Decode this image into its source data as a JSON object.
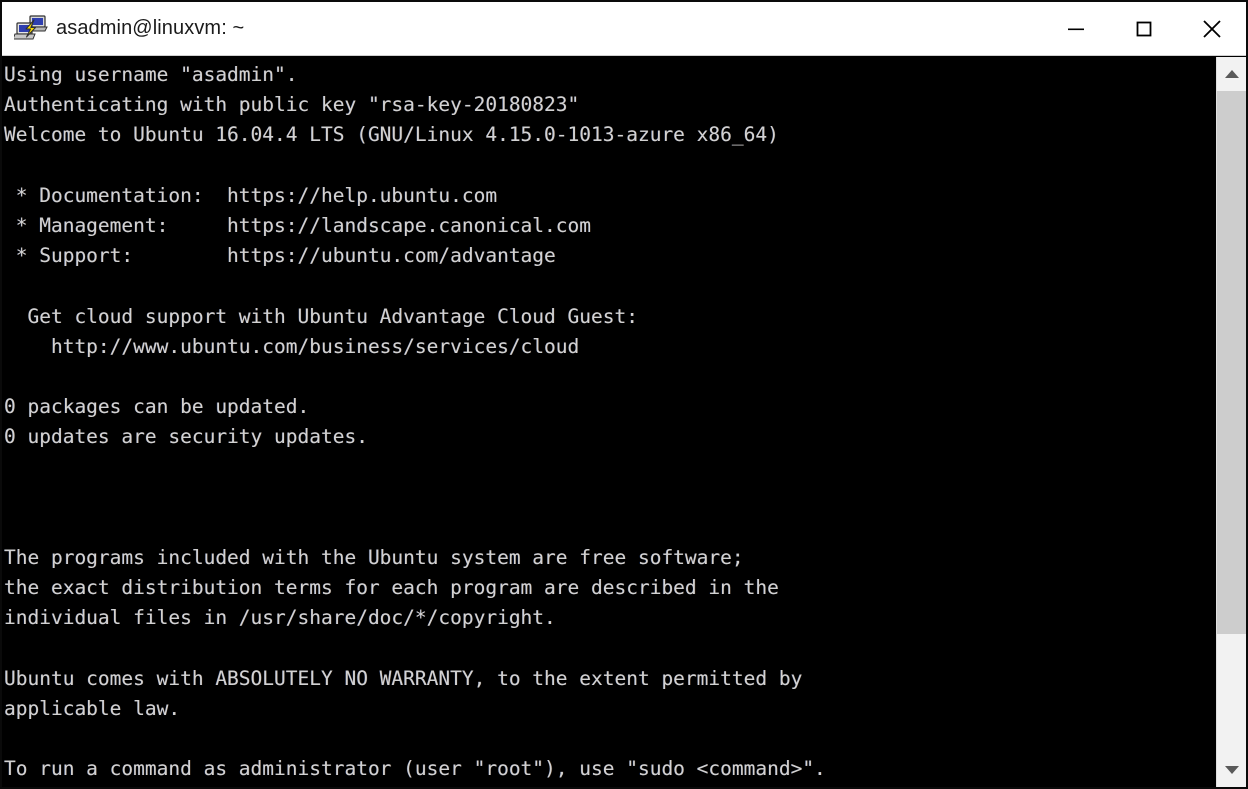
{
  "window": {
    "title": "asadmin@linuxvm: ~",
    "icon": "putty-icon",
    "controls": {
      "minimize_label": "Minimize",
      "maximize_label": "Maximize",
      "close_label": "Close"
    }
  },
  "terminal": {
    "background_color": "#000000",
    "text_color": "#d2d2d2",
    "lines": [
      "Using username \"asadmin\".",
      "Authenticating with public key \"rsa-key-20180823\"",
      "Welcome to Ubuntu 16.04.4 LTS (GNU/Linux 4.15.0-1013-azure x86_64)",
      "",
      " * Documentation:  https://help.ubuntu.com",
      " * Management:     https://landscape.canonical.com",
      " * Support:        https://ubuntu.com/advantage",
      "",
      "  Get cloud support with Ubuntu Advantage Cloud Guest:",
      "    http://www.ubuntu.com/business/services/cloud",
      "",
      "0 packages can be updated.",
      "0 updates are security updates.",
      "",
      "",
      "",
      "The programs included with the Ubuntu system are free software;",
      "the exact distribution terms for each program are described in the",
      "individual files in /usr/share/doc/*/copyright.",
      "",
      "Ubuntu comes with ABSOLUTELY NO WARRANTY, to the extent permitted by",
      "applicable law.",
      "",
      "To run a command as administrator (user \"root\"), use \"sudo <command>\"."
    ]
  },
  "scrollbar": {
    "up_arrow": "chevron-up-icon",
    "down_arrow": "chevron-down-icon",
    "thumb_position_percent": 0,
    "thumb_size_percent": 82
  }
}
